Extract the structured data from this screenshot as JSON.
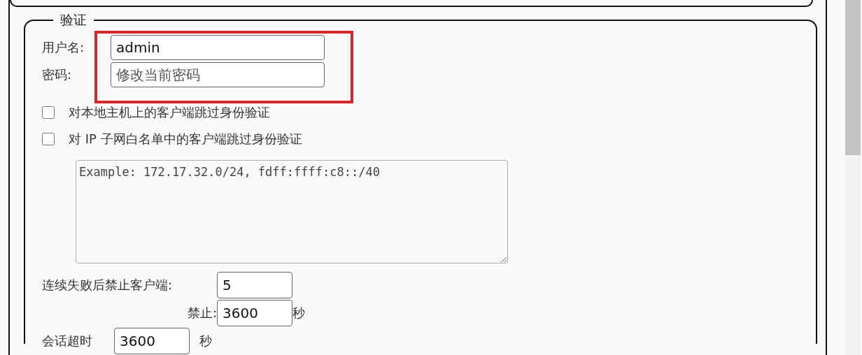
{
  "section": {
    "legend": "验证"
  },
  "username": {
    "label": "用户名:",
    "value": "admin"
  },
  "password": {
    "label": "密码:",
    "placeholder": "修改当前密码"
  },
  "options": [
    {
      "label": "对本地主机上的客户端跳过身份验证",
      "checked": false
    },
    {
      "label": "对 IP 子网白名单中的客户端跳过身份验证",
      "checked": false
    }
  ],
  "whitelist": {
    "placeholder": "Example: 172.17.32.0/24, fdff:ffff:c8::/40"
  },
  "ban_after": {
    "label": "连续失败后禁止客户端:",
    "value": "5"
  },
  "ban_for": {
    "label": "禁止:",
    "value": "3600",
    "unit": "秒"
  },
  "session_timeout": {
    "label": "会话超时",
    "value": "3600",
    "unit": "秒"
  }
}
